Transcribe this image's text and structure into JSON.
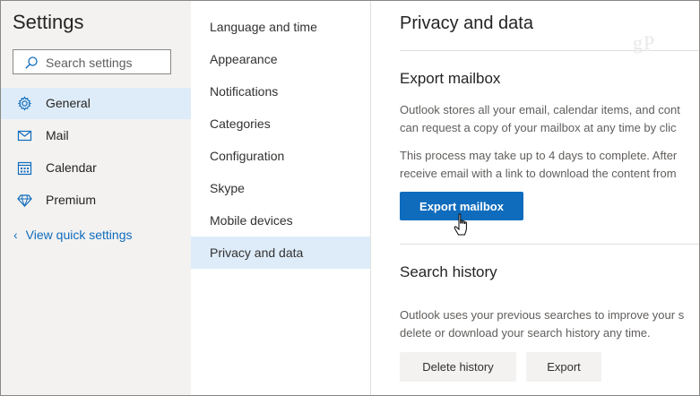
{
  "settings": {
    "title": "Settings",
    "search_placeholder": "Search settings"
  },
  "nav": {
    "items": [
      {
        "label": "General",
        "icon": "gear-icon",
        "selected": true
      },
      {
        "label": "Mail",
        "icon": "mail-icon"
      },
      {
        "label": "Calendar",
        "icon": "calendar-icon"
      },
      {
        "label": "Premium",
        "icon": "diamond-icon"
      }
    ],
    "quick_settings": "View quick settings"
  },
  "subnav": {
    "items": [
      {
        "label": "Language and time"
      },
      {
        "label": "Appearance"
      },
      {
        "label": "Notifications"
      },
      {
        "label": "Categories"
      },
      {
        "label": "Configuration"
      },
      {
        "label": "Skype"
      },
      {
        "label": "Mobile devices"
      },
      {
        "label": "Privacy and data",
        "selected": true
      }
    ]
  },
  "content": {
    "title": "Privacy and data",
    "export": {
      "heading": "Export mailbox",
      "p1_line1": "Outlook stores all your email, calendar items, and cont",
      "p1_line2": "can request a copy of your mailbox at any time by clic",
      "p2_line1": "This process may take up to 4 days to complete. After",
      "p2_line2": "receive email with a link to download the content from",
      "button": "Export mailbox"
    },
    "search_history": {
      "heading": "Search history",
      "p_line1": "Outlook uses your previous searches to improve your s",
      "p_line2": "delete or download your search history any time.",
      "delete_button": "Delete history",
      "export_button": "Export"
    }
  },
  "colors": {
    "accent": "#0f6cbd",
    "selected_bg": "#deecf9",
    "pane_bg": "#f3f2f1"
  }
}
